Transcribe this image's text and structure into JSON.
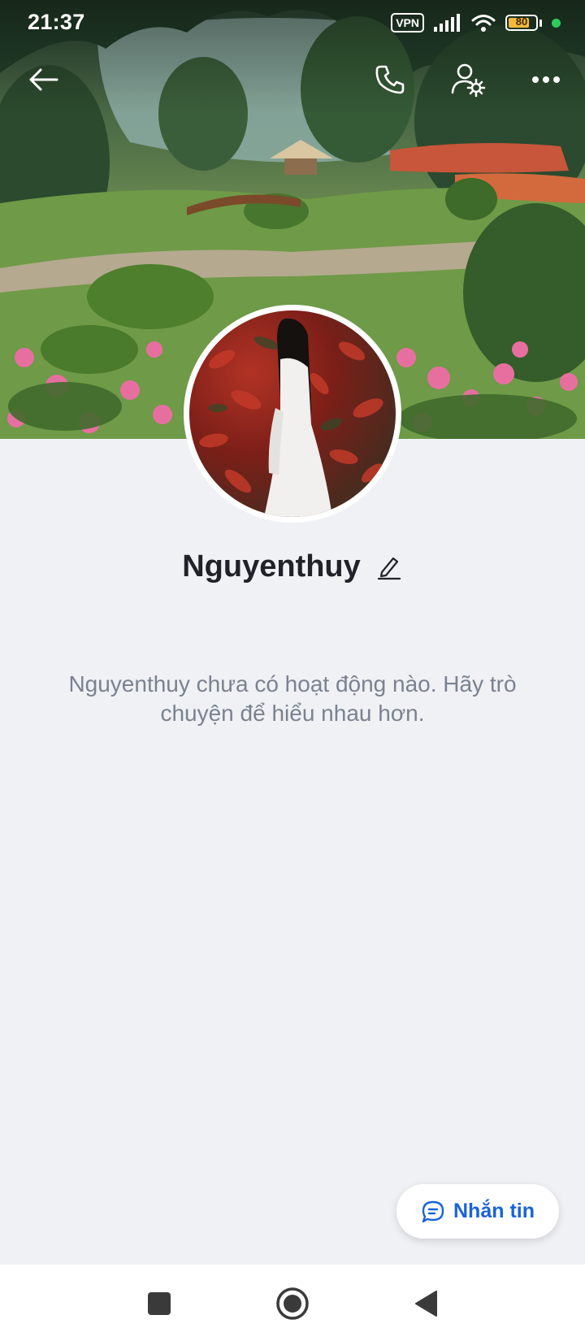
{
  "status_bar": {
    "time": "21:37",
    "vpn_label": "VPN",
    "battery_level": "80",
    "battery_fraction": 0.8,
    "icons": [
      "vpn-icon",
      "signal-icon",
      "wifi-icon",
      "battery-icon",
      "privacy-dot-icon"
    ]
  },
  "header": {
    "icons": [
      "back-arrow-icon",
      "phone-icon",
      "user-settings-icon",
      "more-dots-icon"
    ]
  },
  "profile": {
    "name": "Nguyenthuy",
    "edit_icon": "pencil-icon",
    "empty_message": "Nguyenthuy chưa có hoạt động nào. Hãy trò chuyện để hiểu nhau hơn."
  },
  "actions": {
    "message_label": "Nhắn tin",
    "message_icon": "chat-bubble-icon"
  },
  "nav": {
    "icons": [
      "recent-apps-square-icon",
      "home-circle-icon",
      "back-triangle-icon"
    ]
  },
  "colors": {
    "accent": "#1a63d8",
    "background": "#f0f1f5",
    "muted_text": "#7a8290",
    "battery": "#f5b83d",
    "privacy_dot": "#2ecc5a"
  }
}
